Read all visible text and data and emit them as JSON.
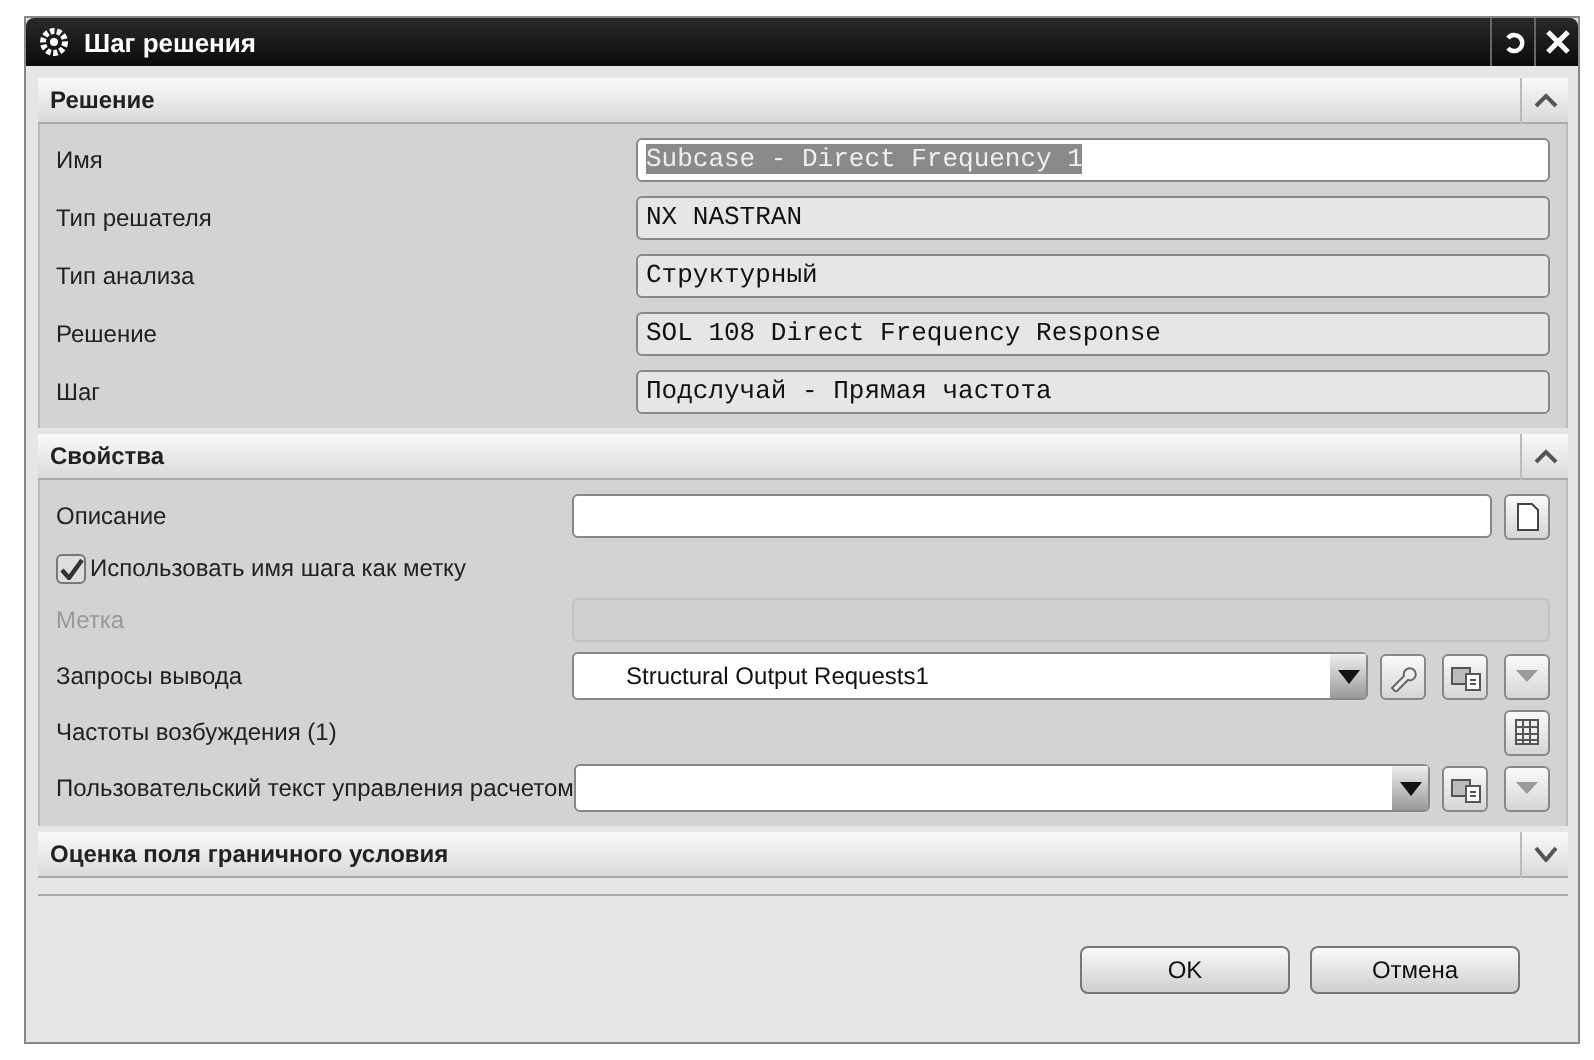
{
  "window": {
    "title": "Шаг решения"
  },
  "sections": [
    {
      "title": "Решение",
      "expanded": true,
      "rows": [
        {
          "kind": "readonly",
          "label": "Имя",
          "value": "Subcase - Direct Frequency 1",
          "text_selected": true
        },
        {
          "kind": "readonly",
          "label": "Тип решателя",
          "value": "NX NASTRAN",
          "text_selected": false
        },
        {
          "kind": "readonly",
          "label": "Тип анализа",
          "value": "Структурный",
          "text_selected": false
        },
        {
          "kind": "readonly",
          "label": "Решение",
          "value": "SOL 108 Direct Frequency Response",
          "text_selected": false
        },
        {
          "kind": "readonly",
          "label": "Шаг",
          "value": "Подслучай - Прямая частота",
          "text_selected": false
        }
      ]
    },
    {
      "title": "Свойства",
      "expanded": true,
      "rows": [
        {
          "kind": "text",
          "label": "Описание",
          "disabled": false,
          "tools": [
            {
              "kind": "page"
            }
          ]
        },
        {
          "kind": "checkbox",
          "label": "Использовать имя шага как метку",
          "checked": true
        },
        {
          "kind": "text",
          "label": "Метка",
          "disabled": true
        },
        {
          "kind": "dropdown",
          "label": "Запросы вывода",
          "value": "Structural Output Requests1",
          "tools": [
            {
              "kind": "wrench"
            },
            {
              "kind": "template"
            },
            {
              "kind": "more"
            }
          ]
        },
        {
          "kind": "list",
          "label": "Частоты возбуждения (1)",
          "tools": [
            {
              "kind": "table"
            }
          ]
        },
        {
          "kind": "dropdown",
          "label": "Пользовательский текст управления расчетом",
          "tools": [
            {
              "kind": "template"
            },
            {
              "kind": "more"
            }
          ]
        }
      ]
    },
    {
      "title": "Оценка поля граничного условия",
      "expanded": false
    }
  ],
  "buttons": [
    "OK",
    "Отмена"
  ]
}
